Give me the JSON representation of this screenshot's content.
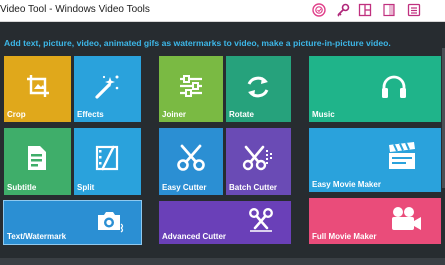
{
  "window": {
    "title": "Video Tool - Windows Video Tools"
  },
  "titlebar_icons": [
    {
      "name": "registration-badge-icon",
      "color": "#e0408a"
    },
    {
      "name": "key-icon",
      "color": "#b0287a"
    },
    {
      "name": "layout-icon",
      "color": "#c0307f"
    },
    {
      "name": "pin-icon",
      "color": "#c0307f"
    },
    {
      "name": "menu-icon",
      "color": "#c0307f"
    }
  ],
  "banner": {
    "text": "Add text, picture, video, animated gifs as watermarks to video, make a picture-in-picture video."
  },
  "tiles": {
    "crop": {
      "label": "Crop",
      "color": "#e0a81b",
      "icon": "crop-icon"
    },
    "effects": {
      "label": "Effects",
      "color": "#2aa2dc",
      "icon": "magic-wand-icon"
    },
    "subtitle": {
      "label": "Subtitle",
      "color": "#3fae6a",
      "icon": "document-icon"
    },
    "split": {
      "label": "Split",
      "color": "#2aa2dc",
      "icon": "film-split-icon"
    },
    "text_watermark": {
      "label": "Text/Watermark",
      "color": "#2b8fd3",
      "icon": "camera-icon"
    },
    "joiner": {
      "label": "Joiner",
      "color": "#7aba43",
      "icon": "equalizer-icon"
    },
    "rotate": {
      "label": "Rotate",
      "color": "#26a27c",
      "icon": "rotate-icon"
    },
    "easy_cutter": {
      "label": "Easy Cutter",
      "color": "#2b8fd3",
      "icon": "scissors-icon"
    },
    "batch_cutter": {
      "label": "Batch Cutter",
      "color": "#6a4bb5",
      "icon": "batch-scissors-icon"
    },
    "advanced_cutter": {
      "label": "Advanced Cutter",
      "color": "#6a40b8",
      "icon": "advanced-scissors-icon"
    },
    "music": {
      "label": "Music",
      "color": "#1fb48a",
      "icon": "headphones-icon"
    },
    "easy_movie_maker": {
      "label": "Easy Movie Maker",
      "color": "#2aa2dc",
      "icon": "clapperboard-icon"
    },
    "full_movie_maker": {
      "label": "Full Movie Maker",
      "color": "#ea4c7a",
      "icon": "movie-camera-icon"
    }
  }
}
